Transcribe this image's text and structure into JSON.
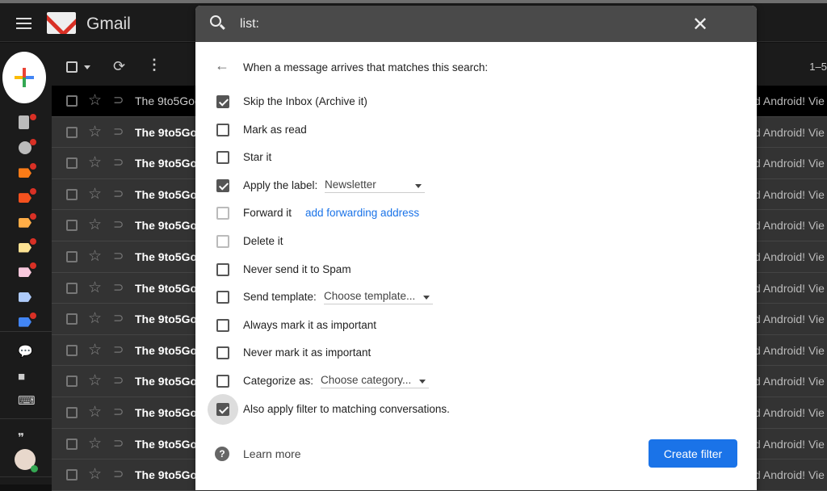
{
  "app": {
    "name": "Gmail"
  },
  "toolbar": {
    "pager": "1–5"
  },
  "rail": {
    "icons": [
      {
        "name": "drafts-icon",
        "color": "#bbbbbb",
        "dot": true
      },
      {
        "name": "spam-icon",
        "color": "#bbbbbb",
        "dot": true
      },
      {
        "name": "label-icon",
        "color": "#fa7b17",
        "dot": true
      },
      {
        "name": "label-icon",
        "color": "#f4511e",
        "dot": true
      },
      {
        "name": "label-icon",
        "color": "#ffad47",
        "dot": true
      },
      {
        "name": "label-icon",
        "color": "#fde293",
        "dot": true
      },
      {
        "name": "label-icon",
        "color": "#f8c8dc",
        "dot": true
      },
      {
        "name": "label-icon",
        "color": "#aecbfa",
        "dot": false
      },
      {
        "name": "label-icon",
        "color": "#4285f4",
        "dot": true
      }
    ]
  },
  "emails": [
    {
      "sender": "The 9to5Goo",
      "snippet": "d Android! Vie",
      "read": true
    },
    {
      "sender": "The 9to5Goo",
      "snippet": "d Android! Vie",
      "read": false
    },
    {
      "sender": "The 9to5Goo",
      "snippet": "d Android! Vie",
      "read": false
    },
    {
      "sender": "The 9to5Goo",
      "snippet": "d Android! Vie",
      "read": false
    },
    {
      "sender": "The 9to5Goo",
      "snippet": "d Android! Vie",
      "read": false
    },
    {
      "sender": "The 9to5Goo",
      "snippet": "d Android! Vie",
      "read": false
    },
    {
      "sender": "The 9to5Goo",
      "snippet": "d Android! Vie",
      "read": false
    },
    {
      "sender": "The 9to5Goo",
      "snippet": "d Android! Vie",
      "read": false
    },
    {
      "sender": "The 9to5Goo",
      "snippet": "d Android! Vie",
      "read": false
    },
    {
      "sender": "The 9to5Goo",
      "snippet": "d Android! Vie",
      "read": false
    },
    {
      "sender": "The 9to5Goo",
      "snippet": "d Android! Vie",
      "read": false
    },
    {
      "sender": "The 9to5Goo",
      "snippet": "d Android! Vie",
      "read": false
    },
    {
      "sender": "The 9to5Goo",
      "snippet": "d Android! Vie",
      "read": false
    }
  ],
  "dialog": {
    "query": "list:",
    "close": "✕",
    "intro": "When a message arrives that matches this search:",
    "options": [
      {
        "label": "Skip the Inbox (Archive it)",
        "checked": true
      },
      {
        "label": "Mark as read",
        "checked": false
      },
      {
        "label": "Star it",
        "checked": false
      },
      {
        "label": "Apply the label:",
        "checked": true,
        "select": "Newsletter"
      },
      {
        "label": "Forward it",
        "checked": false,
        "disabled": true,
        "link": "add forwarding address"
      },
      {
        "label": "Delete it",
        "checked": false,
        "disabled": true
      },
      {
        "label": "Never send it to Spam",
        "checked": false
      },
      {
        "label": "Send template:",
        "checked": false,
        "select": "Choose template..."
      },
      {
        "label": "Always mark it as important",
        "checked": false
      },
      {
        "label": "Never mark it as important",
        "checked": false
      },
      {
        "label": "Categorize as:",
        "checked": false,
        "select": "Choose category..."
      },
      {
        "label": "Also apply filter to matching conversations.",
        "checked": true,
        "focused": true
      }
    ],
    "learn_more": "Learn more",
    "create_filter": "Create filter",
    "accent": "#1a73e8"
  }
}
